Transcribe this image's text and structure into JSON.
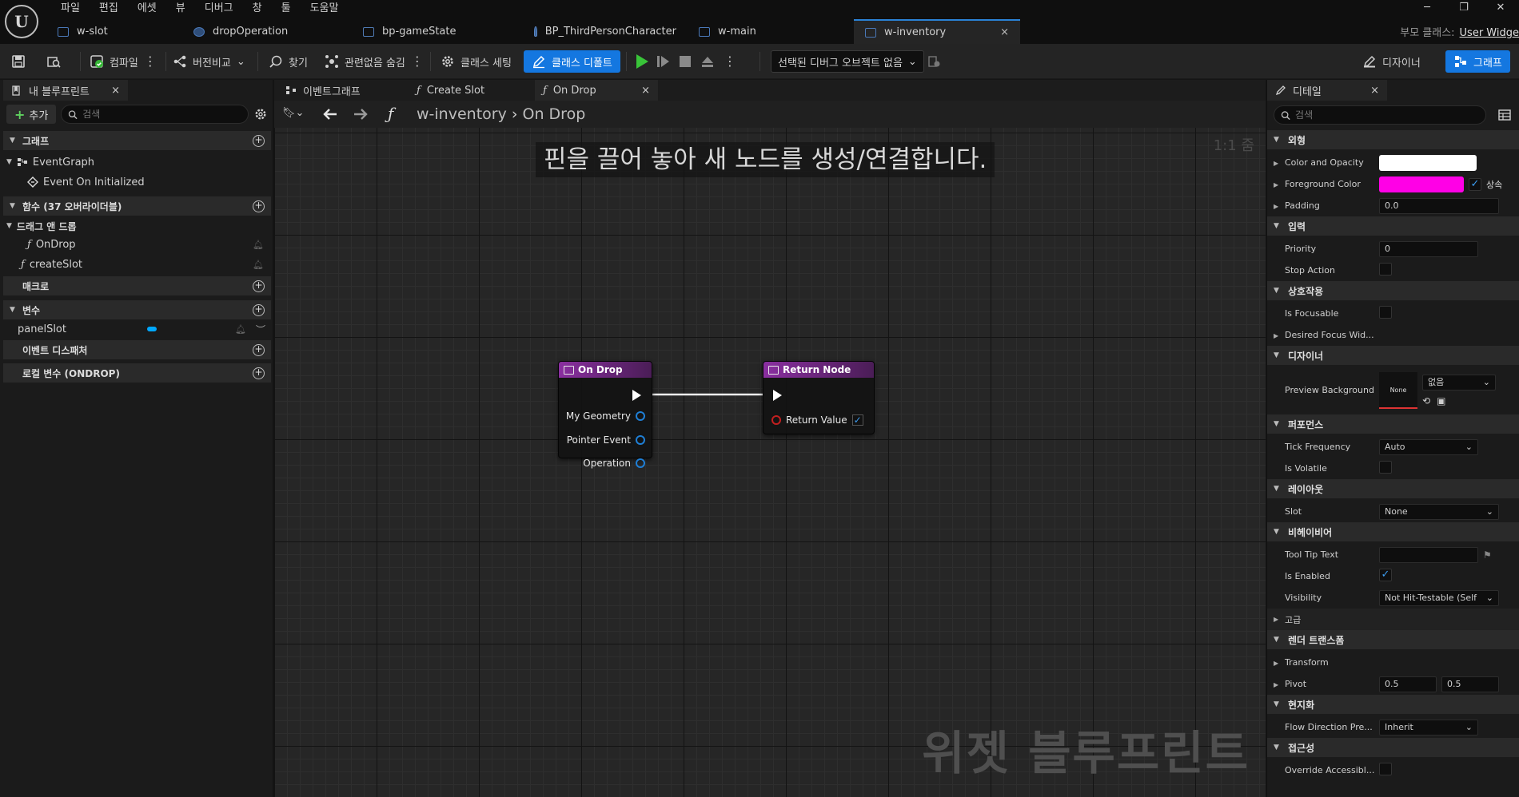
{
  "menu": [
    "파일",
    "편집",
    "에셋",
    "뷰",
    "디버그",
    "창",
    "툴",
    "도움말"
  ],
  "doc_tabs": [
    {
      "label": "w-slot"
    },
    {
      "label": "dropOperation"
    },
    {
      "label": "bp-gameState"
    },
    {
      "label": "BP_ThirdPersonCharacter"
    },
    {
      "label": "w-main"
    },
    {
      "label": "w-inventory",
      "close": "×"
    }
  ],
  "parent_class": {
    "label": "부모 클래스:",
    "value": "User Widge"
  },
  "window_controls": {
    "minimize": "─",
    "restore": "❐",
    "close": "✕"
  },
  "toolbar": {
    "compile": "컴파일",
    "diff": "버전비교",
    "find": "찾기",
    "hide_unrelated": "관련없음 숨김",
    "class_settings": "클래스 세팅",
    "class_defaults": "클래스 디폴트",
    "debug_object": "선택된 디버그 오브젝트 없음",
    "designer": "디자이너",
    "graph": "그래프"
  },
  "left_panel": {
    "tab_label": "내 블루프린트",
    "add_label": "추가",
    "search_placeholder": "검색",
    "sections": {
      "graphs": "그래프",
      "event_graph": "EventGraph",
      "event_on_initialized": "Event On Initialized",
      "functions": "함수 (37 오버라이더블)",
      "drag_drop": "드래그 앤 드롭",
      "on_drop": "OnDrop",
      "create_slot": "createSlot",
      "macros": "매크로",
      "variables": "변수",
      "panel_slot": "panelSlot",
      "dispatchers": "이벤트 디스패처",
      "local_vars": "로컬 변수 (ONDROP)"
    }
  },
  "graph": {
    "tabs": [
      {
        "label": "이벤트그래프"
      },
      {
        "label": "Create Slot"
      },
      {
        "label": "On Drop",
        "close": "×"
      }
    ],
    "breadcrumb": {
      "root": "w-inventory",
      "current": "On Drop"
    },
    "zoom": "1:1 줌",
    "hint": "핀을 끌어 놓아 새 노드를 생성/연결합니다.",
    "watermark": "위젯 블루프린트",
    "nodes": {
      "on_drop": {
        "title": "On Drop",
        "pins": [
          "My Geometry",
          "Pointer Event",
          "Operation"
        ]
      },
      "return_node": {
        "title": "Return Node",
        "pin": "Return Value"
      }
    }
  },
  "details": {
    "tab_label": "디테일",
    "search_placeholder": "검색",
    "appearance": "외형",
    "color_opacity": "Color and Opacity",
    "foreground_color": "Foreground Color",
    "inherit": "상속",
    "padding": "Padding",
    "padding_value": "0.0",
    "input": "입력",
    "priority": "Priority",
    "priority_value": "0",
    "stop_action": "Stop Action",
    "interaction": "상호작용",
    "is_focusable": "Is Focusable",
    "desired_focus": "Desired Focus Wid...",
    "designer": "디자이너",
    "preview_bg": "Preview Background",
    "preview_none": "None",
    "preview_select": "없음",
    "performance": "퍼포먼스",
    "tick_frequency": "Tick Frequency",
    "tick_value": "Auto",
    "is_volatile": "Is Volatile",
    "layout": "레이아웃",
    "slot": "Slot",
    "slot_value": "None",
    "behavior": "비헤이비어",
    "tooltip_text": "Tool Tip Text",
    "is_enabled": "Is Enabled",
    "visibility": "Visibility",
    "visibility_value": "Not Hit-Testable (Self",
    "advanced": "고급",
    "render_transform": "렌더 트랜스폼",
    "transform": "Transform",
    "pivot": "Pivot",
    "pivot_x": "0.5",
    "pivot_y": "0.5",
    "localization": "현지화",
    "flow_direction": "Flow Direction Pre...",
    "flow_value": "Inherit",
    "accessibility": "접근성",
    "override_access": "Override Accessibl..."
  },
  "colors": {
    "accent": "#1477e0",
    "color_opacity_swatch": "#ffffff",
    "foreground_swatch": "#ff00e6",
    "node_header": "#8a2fa0",
    "variable_pin": "#00a8ff"
  }
}
